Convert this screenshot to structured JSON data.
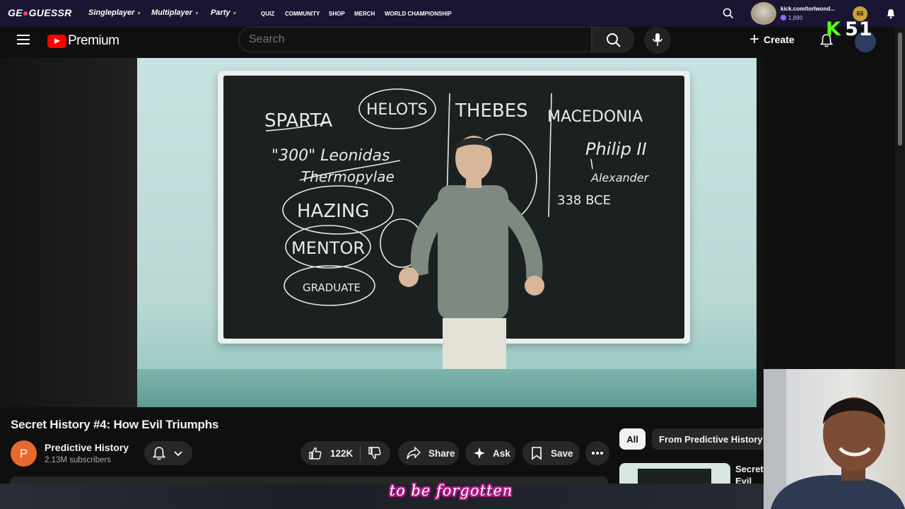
{
  "geoguessr": {
    "logo": "GEOGUESSR",
    "logo_a": "GE",
    "logo_b": "GUESSR",
    "nav": [
      {
        "label": "Singleplayer"
      },
      {
        "label": "Multiplayer"
      },
      {
        "label": "Party"
      }
    ],
    "nav_small": [
      "QUIZ",
      "COMMUNITY",
      "SHOP",
      "MERCH",
      "WORLD CHAMPIONSHIP"
    ],
    "user": "kick.com/torlwond...",
    "coins": "1,890",
    "level": "66"
  },
  "kick": {
    "letter": "K",
    "count": "51"
  },
  "youtube": {
    "logo_text": "Premium",
    "search_placeholder": "Search",
    "create_label": "Create"
  },
  "video": {
    "title": "Secret History #4: How Evil Triumphs",
    "board": {
      "sparta": "SPARTA",
      "helots": "HELOTS",
      "three_hundred": "\"300\" Leonidas",
      "thermopylae": "Thermopylae",
      "hazing": "HAZING",
      "mentor": "MENTOR",
      "graduate": "GRADUATE",
      "thebes": "THEBES",
      "macedonia": "MACEDONIA",
      "philip": "Philip II",
      "alexander": "Alexander",
      "date": "338 BCE"
    }
  },
  "channel": {
    "avatar_letter": "P",
    "name": "Predictive History",
    "subscribers": "2.13M subscribers"
  },
  "actions": {
    "likes": "122K",
    "share": "Share",
    "ask": "Ask",
    "save": "Save"
  },
  "sidebar": {
    "chips": [
      "All",
      "From Predictive History"
    ],
    "next_title": "Secret Evil"
  },
  "caption": "to be forgotten",
  "colors": {
    "geo_bar": "#1a1533",
    "yt_background": "#0f0f0f",
    "yt_red": "#ff0000",
    "kick_green": "#53fc18",
    "caption_outline": "#b01a8a"
  }
}
